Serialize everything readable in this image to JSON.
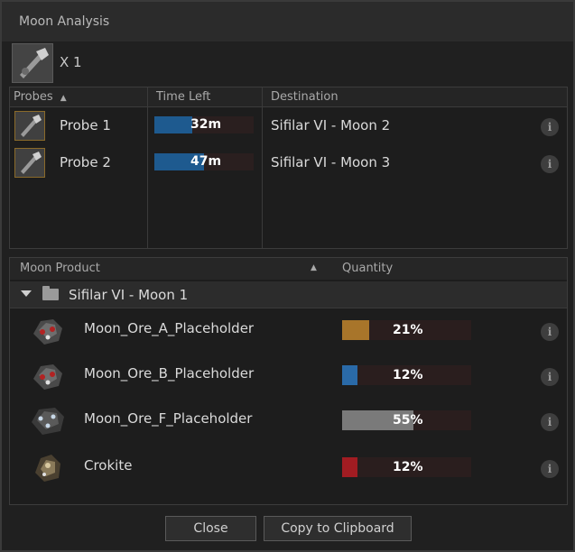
{
  "window": {
    "title": "Moon Analysis"
  },
  "ship": {
    "icon": "probe-launcher-icon",
    "count_label": "X 1"
  },
  "probes_table": {
    "headers": {
      "probes": "Probes",
      "time_left": "Time Left",
      "destination": "Destination"
    },
    "sort_indicator": "▲",
    "rows": [
      {
        "name": "Probe 1",
        "time_left": "32m",
        "time_progress": 0.38,
        "destination": "Sifilar VI - Moon 2"
      },
      {
        "name": "Probe 2",
        "time_left": "47m",
        "time_progress": 0.5,
        "destination": "Sifilar VI - Moon 3"
      }
    ]
  },
  "products_table": {
    "headers": {
      "moon_product": "Moon Product",
      "quantity": "Quantity"
    },
    "sort_indicator": "▲",
    "group": "Sifilar VI - Moon 1",
    "rows": [
      {
        "name": "Moon_Ore_A_Placeholder",
        "quantity": "21%",
        "percent": 21,
        "color": "#a8752a"
      },
      {
        "name": "Moon_Ore_B_Placeholder",
        "quantity": "12%",
        "percent": 12,
        "color": "#2a6aa8"
      },
      {
        "name": "Moon_Ore_F_Placeholder",
        "quantity": "55%",
        "percent": 55,
        "color": "#7a7a7a"
      },
      {
        "name": "Crokite",
        "quantity": "12%",
        "percent": 12,
        "color": "#a11c22"
      }
    ]
  },
  "info_label": "i",
  "buttons": {
    "close": "Close",
    "copy": "Copy to Clipboard"
  }
}
